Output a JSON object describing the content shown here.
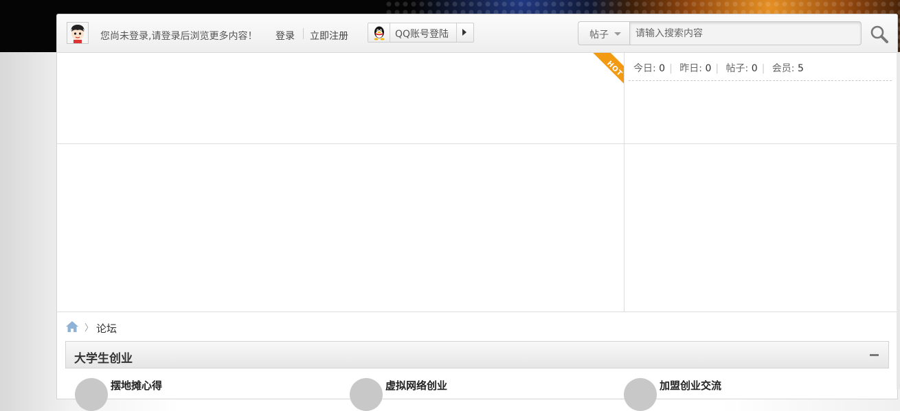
{
  "header": {
    "login_message": "您尚未登录,请登录后浏览更多内容！",
    "login_link": "登录",
    "register_link": "立即注册",
    "qq_login_label": "QQ账号登陆",
    "icons": {
      "avatar": "cartoon-avatar-icon",
      "qq": "qq-penguin-icon",
      "search": "magnifier-icon"
    }
  },
  "search": {
    "type_label": "帖子",
    "placeholder": "请输入搜索内容"
  },
  "hot_badge": "HOT",
  "stats": {
    "today_label": "今日:",
    "today_value": "0",
    "yesterday_label": "昨日:",
    "yesterday_value": "0",
    "posts_label": "帖子:",
    "posts_value": "0",
    "members_label": "会员:",
    "members_value": "5"
  },
  "breadcrumb": {
    "separator": "〉",
    "current": "论坛"
  },
  "section": {
    "title": "大学生创业",
    "collapse_icon": "minus-icon",
    "forums": [
      {
        "name": "摆地摊心得"
      },
      {
        "name": "虚拟网络创业"
      },
      {
        "name": "加盟创业交流"
      }
    ]
  },
  "colors": {
    "hot_ribbon": "#f29a12",
    "top_band": "#050505",
    "accent_orange": "#ff9a28"
  }
}
